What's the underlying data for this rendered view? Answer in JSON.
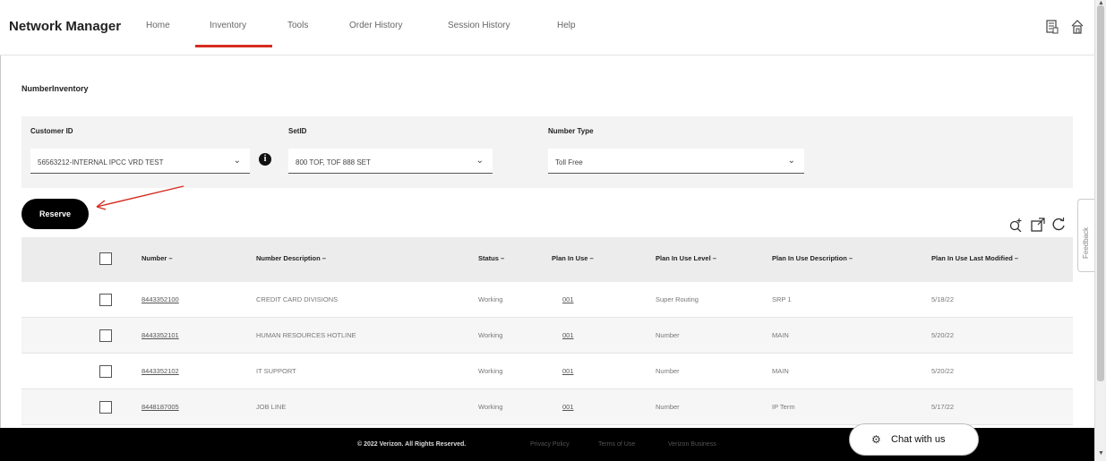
{
  "nav": {
    "brand": "Network Manager",
    "items": [
      {
        "label": "Home"
      },
      {
        "label": "Inventory"
      },
      {
        "label": "Tools"
      },
      {
        "label": "Order History"
      },
      {
        "label": "Session History"
      },
      {
        "label": "Help"
      }
    ],
    "active": "Inventory",
    "icons": [
      "document-icon",
      "home-icon"
    ]
  },
  "page": {
    "title": "NumberInventory"
  },
  "filters": {
    "customer_id_label": "Customer ID",
    "customer_id_value": "56563212-INTERNAL IPCC VRD TEST",
    "set_id_label": "SetID",
    "set_id_value": "800 TOF, TOF 888 SET",
    "number_type_label": "Number Type",
    "number_type_value": "Toll Free",
    "info_glyph": "i"
  },
  "actions": {
    "reserve_label": "Reserve",
    "tool_icons": [
      "search-add-icon",
      "external-link-icon",
      "refresh-icon"
    ]
  },
  "feedback": {
    "label": "Feedback"
  },
  "table": {
    "headers": [
      "Number –",
      "Number Description –",
      "Status –",
      "Plan In Use –",
      "Plan In Use Level –",
      "Plan In Use Description –",
      "Plan In Use Last Modified –"
    ],
    "rows": [
      [
        "8443352100",
        "CREDIT CARD DIVISIONS",
        "Working",
        "001",
        "Super Routing",
        "SRP 1",
        "5/18/22"
      ],
      [
        "8443352101",
        "HUMAN RESOURCES HOTLINE",
        "Working",
        "001",
        "Number",
        "MAIN",
        "5/20/22"
      ],
      [
        "8443352102",
        "IT SUPPORT",
        "Working",
        "001",
        "Number",
        "MAIN",
        "5/20/22"
      ],
      [
        "8448187005",
        "JOB LINE",
        "Working",
        "001",
        "Number",
        "IP Term",
        "5/17/22"
      ]
    ]
  },
  "footer": {
    "copyright": "© 2022 Verizon. All Rights Reserved.",
    "links": [
      "Privacy Policy",
      "Terms of Use",
      "Verizon Business"
    ]
  },
  "chat": {
    "label": "Chat with us"
  },
  "colors": {
    "accent": "#d52b1e",
    "footer_bg": "#000000",
    "header_bg": "#ececec"
  }
}
